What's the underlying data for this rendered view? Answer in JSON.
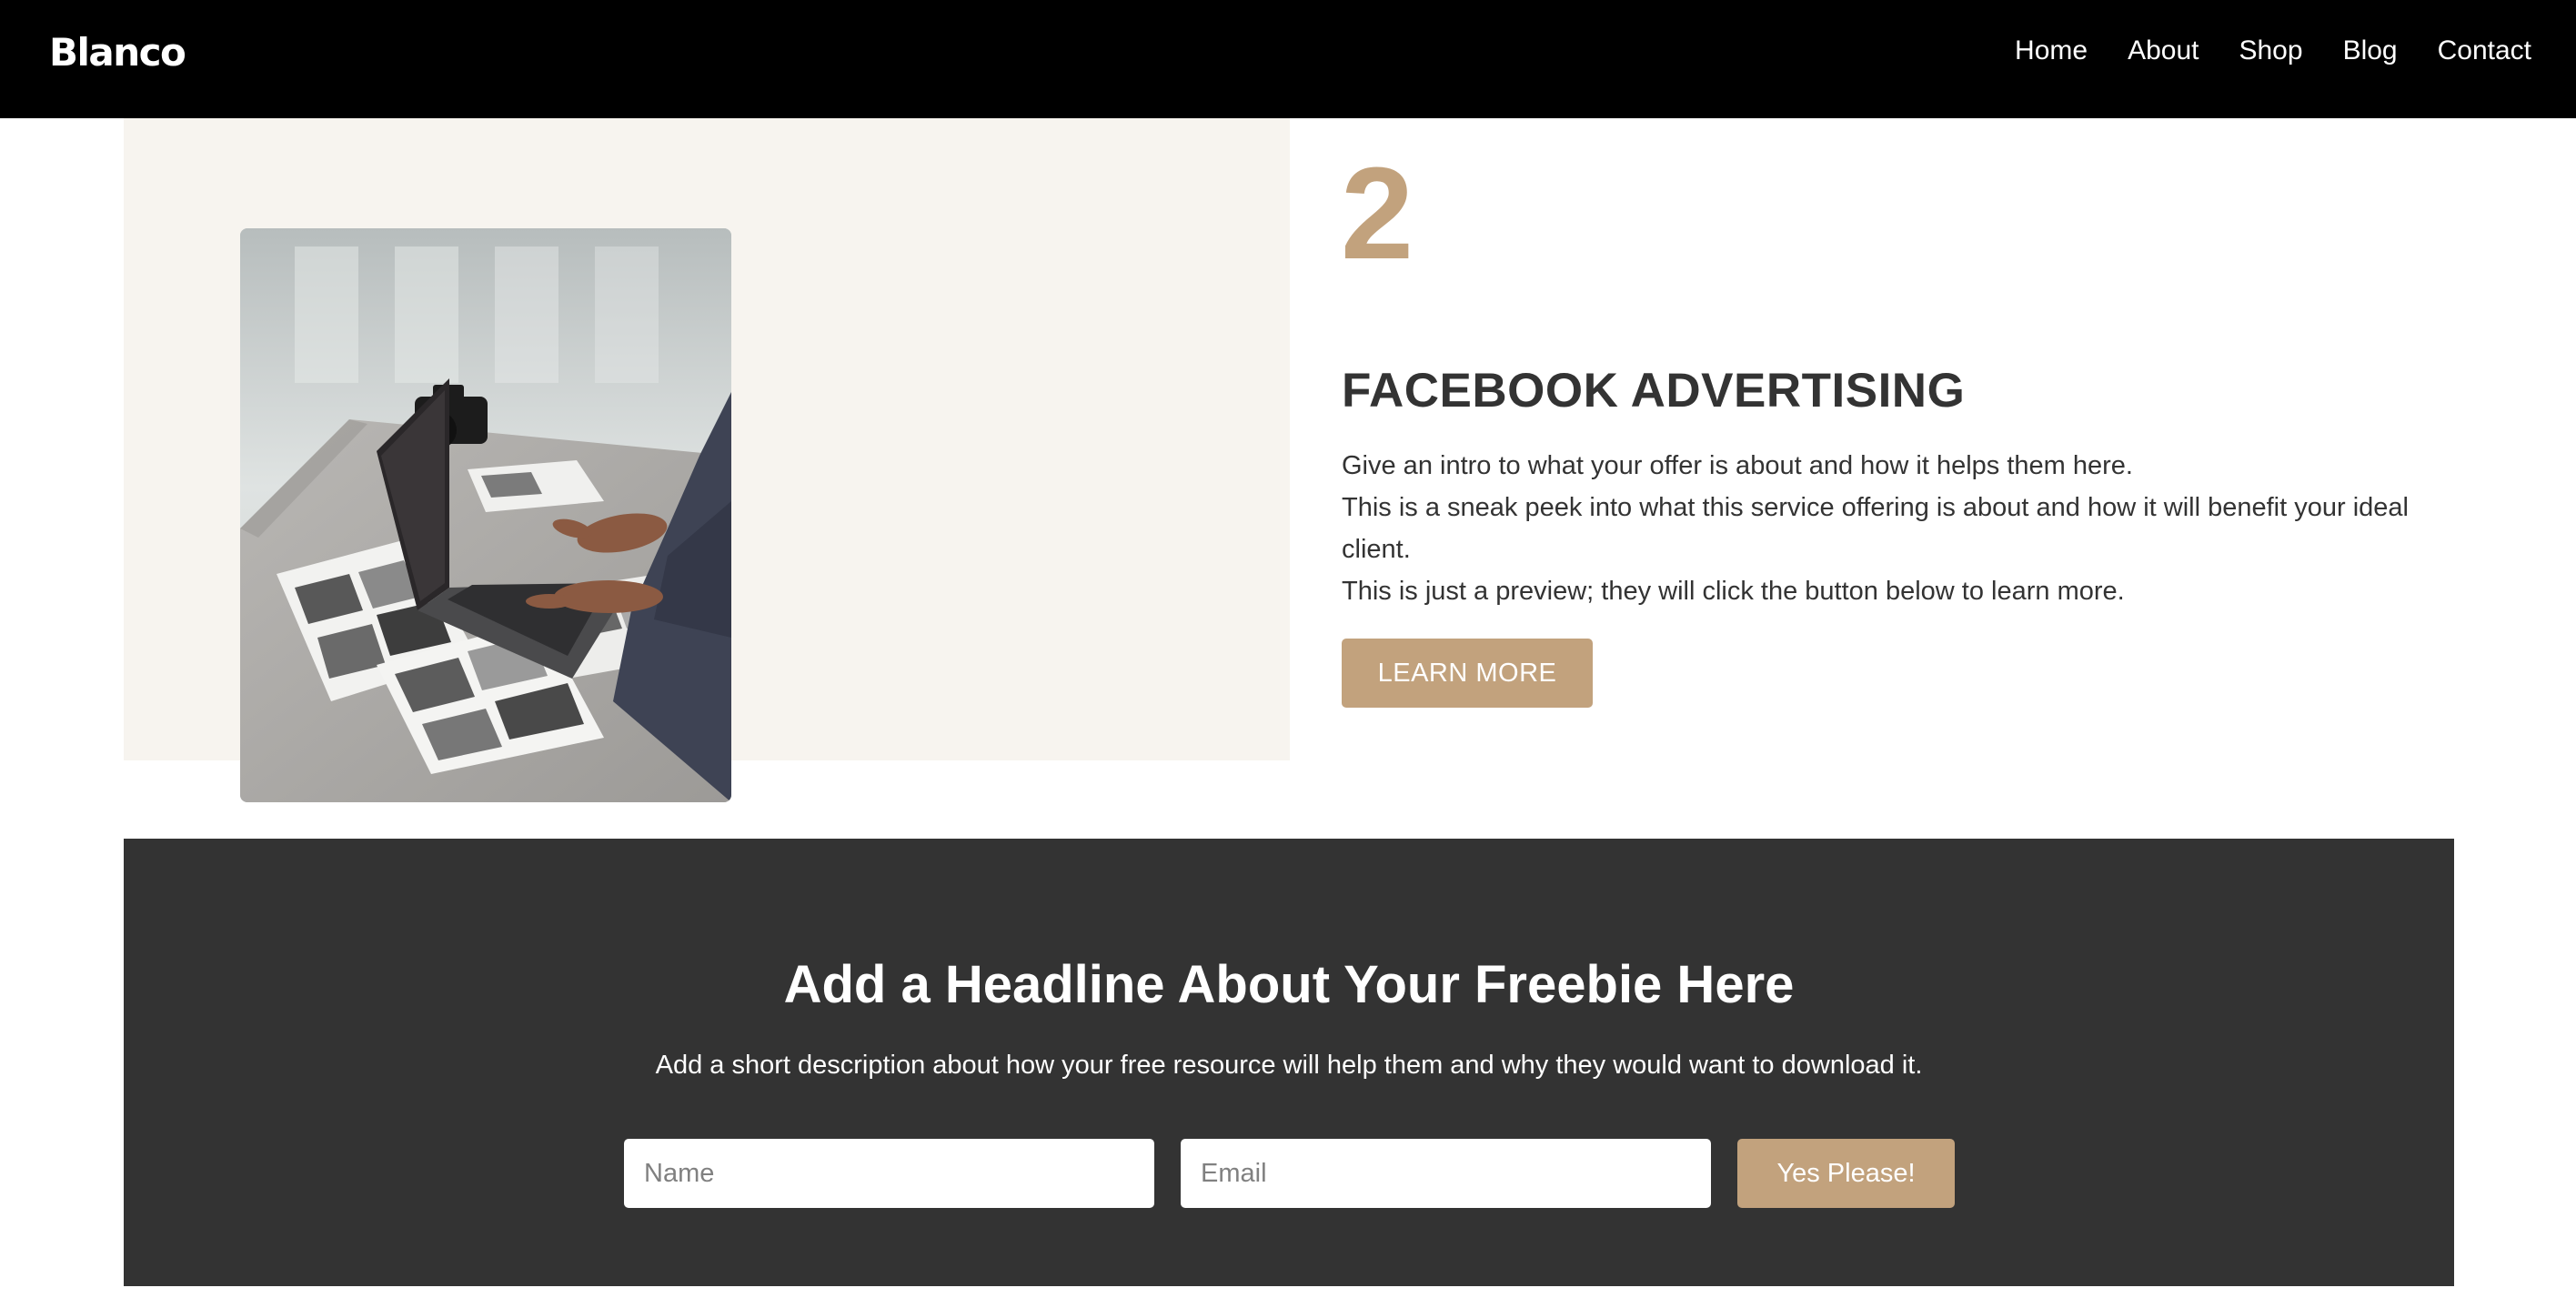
{
  "header": {
    "brand": "Blanco",
    "nav": [
      "Home",
      "About",
      "Shop",
      "Blog",
      "Contact"
    ]
  },
  "feature": {
    "number": "2",
    "title": "FACEBOOK ADVERTISING",
    "paragraphs": [
      "Give an intro to what your offer is about and how it helps them here.",
      "This is a sneak peek into what this service offering is about and how it will benefit your ideal client.",
      "This is just a preview; they will click the button below to learn more."
    ],
    "button_label": "LEARN MORE",
    "image_subject": "workspace-photo"
  },
  "freebie": {
    "headline": "Add a Headline About Your Freebie Here",
    "description": "Add a short description about how your free resource will help them and why they would want to download it.",
    "name_placeholder": "Name",
    "email_placeholder": "Email",
    "button_label": "Yes Please!"
  },
  "colors": {
    "header_bg": "#000000",
    "accent": "#c2a27d",
    "feature_bg": "#f7f4ef",
    "freebie_bg": "#333333",
    "body_text": "#333333"
  }
}
